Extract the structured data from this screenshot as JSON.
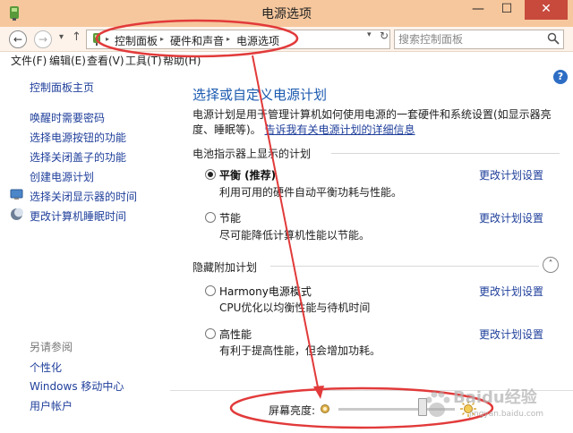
{
  "window": {
    "title": "电源选项",
    "close_glyph": "✕",
    "min_glyph": "—",
    "max_glyph": "☐"
  },
  "nav": {
    "back_glyph": "←",
    "forward_glyph": "→",
    "history_glyph": "▾",
    "up_glyph": "↑",
    "breadcrumbs": [
      "控制面板",
      "硬件和声音",
      "电源选项"
    ],
    "sep_glyph": "▸",
    "dropdown_glyph": "▾",
    "refresh_glyph": "↻",
    "search_placeholder": "搜索控制面板"
  },
  "menu": [
    "文件(F)",
    "编辑(E)",
    "查看(V)",
    "工具(T)",
    "帮助(H)"
  ],
  "sidebar": {
    "home": "控制面板主页",
    "links": [
      "唤醒时需要密码",
      "选择电源按钮的功能",
      "选择关闭盖子的功能",
      "创建电源计划",
      "选择关闭显示器的时间",
      "更改计算机睡眠时间"
    ],
    "see_also_title": "另请参阅",
    "see_also": [
      "个性化",
      "Windows 移动中心",
      "用户帐户"
    ]
  },
  "main": {
    "help_glyph": "?",
    "heading": "选择或自定义电源计划",
    "description": "电源计划是用于管理计算机如何使用电源的一套硬件和系统设置(如显示器亮度、睡眠等)。",
    "description_link": "告诉我有关电源计划的详细信息",
    "group_battery": "电池指示器上显示的计划",
    "group_hidden": "隐藏附加计划",
    "collapse_glyph": "˄",
    "change_label": "更改计划设置",
    "plans": [
      {
        "name": "平衡 (推荐)",
        "desc": "利用可用的硬件自动平衡功耗与性能。",
        "selected": true
      },
      {
        "name": "节能",
        "desc": "尽可能降低计算机性能以节能。",
        "selected": false
      },
      {
        "name": "Harmony电源模式",
        "desc": "CPU优化以均衡性能与待机时间",
        "selected": false
      },
      {
        "name": "高性能",
        "desc": "有利于提高性能，但会增加功耗。",
        "selected": false
      }
    ]
  },
  "brightness": {
    "label": "屏幕亮度:",
    "level": 0.72
  },
  "watermark": {
    "text": "Baidu经验",
    "sub": "jingyan.baidu.com"
  },
  "colors": {
    "titlebar": "#f6c79d",
    "link": "#1f3f9b",
    "heading": "#1b5aaf",
    "annotation": "#e23a3a"
  }
}
